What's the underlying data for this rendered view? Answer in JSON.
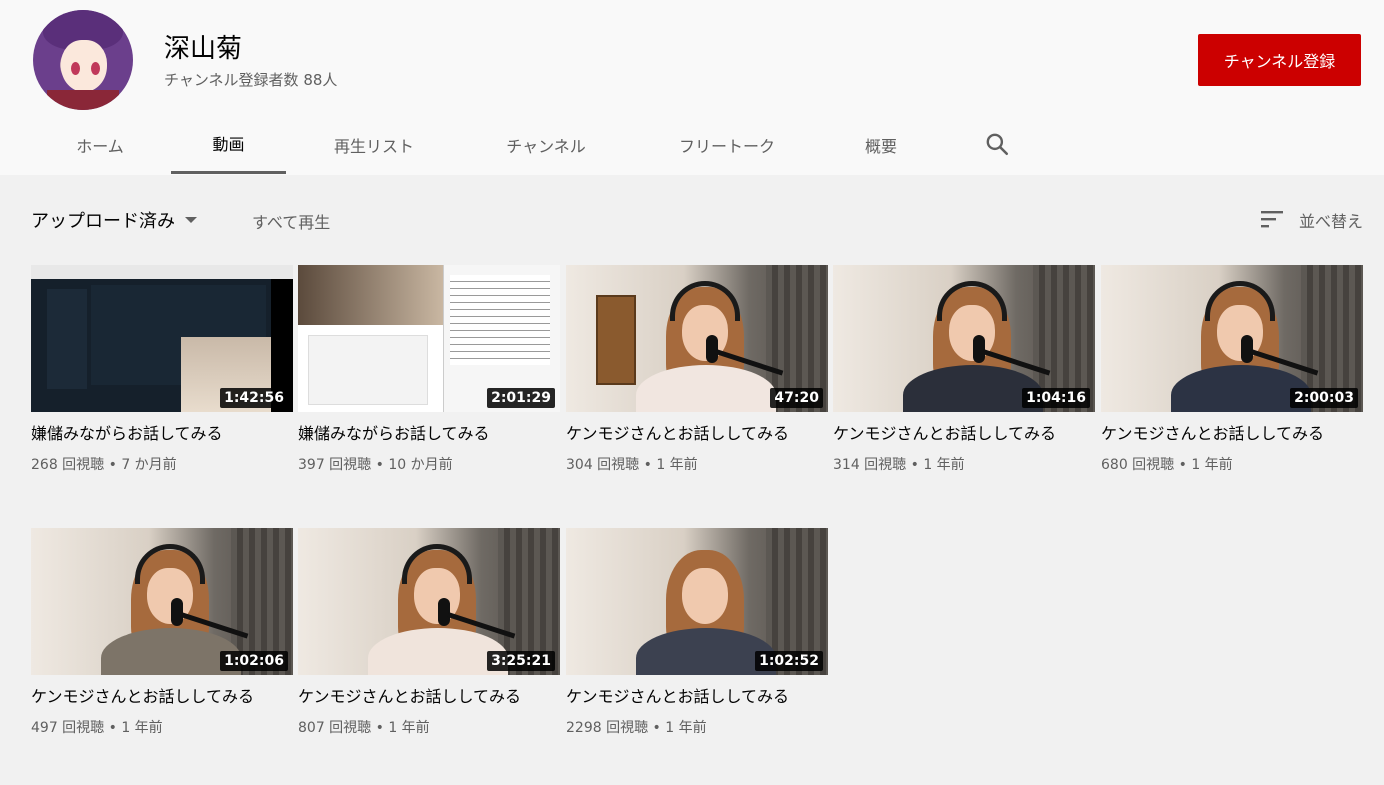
{
  "channel": {
    "name": "深山菊",
    "subscribers": "チャンネル登録者数 88人",
    "subscribe_label": "チャンネル登録"
  },
  "tabs": [
    {
      "label": "ホーム",
      "active": false
    },
    {
      "label": "動画",
      "active": true
    },
    {
      "label": "再生リスト",
      "active": false
    },
    {
      "label": "チャンネル",
      "active": false
    },
    {
      "label": "フリートーク",
      "active": false
    },
    {
      "label": "概要",
      "active": false
    }
  ],
  "toolbar": {
    "filter_label": "アップロード済み",
    "play_all_label": "すべて再生",
    "sort_label": "並べ替え"
  },
  "videos": [
    {
      "title": "嫌儲みながらお話してみる",
      "duration": "1:42:56",
      "meta": "268 回視聴 • 7 か月前",
      "thumb": "twitter"
    },
    {
      "title": "嫌儲みながらお話してみる",
      "duration": "2:01:29",
      "meta": "397 回視聴 • 10 か月前",
      "thumb": "split"
    },
    {
      "title": "ケンモジさんとお話ししてみる",
      "duration": "47:20",
      "meta": "304 回視聴 • 1 年前",
      "thumb": "room"
    },
    {
      "title": "ケンモジさんとお話ししてみる",
      "duration": "1:04:16",
      "meta": "314 回視聴 • 1 年前",
      "thumb": "room"
    },
    {
      "title": "ケンモジさんとお話ししてみる",
      "duration": "2:00:03",
      "meta": "680 回視聴 • 1 年前",
      "thumb": "room"
    },
    {
      "title": "ケンモジさんとお話ししてみる",
      "duration": "1:02:06",
      "meta": "497 回視聴 • 1 年前",
      "thumb": "room"
    },
    {
      "title": "ケンモジさんとお話ししてみる",
      "duration": "3:25:21",
      "meta": "807 回視聴 • 1 年前",
      "thumb": "room"
    },
    {
      "title": "ケンモジさんとお話ししてみる",
      "duration": "1:02:52",
      "meta": "2298 回視聴 • 1 年前",
      "thumb": "room"
    }
  ],
  "colors": {
    "subscribe_bg": "#cc0000",
    "header_bg": "#f9f9f9",
    "page_bg": "#f1f1f1"
  },
  "icons": {
    "search": "search-icon",
    "sort": "sort-icon",
    "dropdown": "chevron-down-icon"
  }
}
